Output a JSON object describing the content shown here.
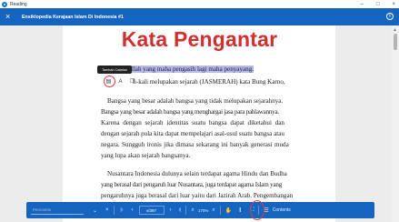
{
  "window": {
    "app_title": "Reading",
    "controls": {
      "minimize": "–",
      "maximize": "□",
      "close": "×"
    }
  },
  "appbar": {
    "close_icon": "×",
    "book_title": "Ensiklopedia Kerajaan Islam Di Indonesia #1",
    "info_icon": "i"
  },
  "page": {
    "heading": "Kata Pengantar",
    "highlighted_line": "nama Allah yang maha pengasih lagi maha penyayang.",
    "lines": [
      "li-kali melupakan sejarah (JASMERAH) kata Bung Karno,",
      "Bangsa yang besar adalah bangsa yang tidak melupakan sejarahnya.",
      "Bangsa yang besar adalah bangsa yang menghargai jasa para pahlawannya.",
      "Karena dengan sejarah identitas suatu bangsa dapat diketahui dan",
      "dengan sejarah pula kita dapat mempelajari asal-usul suatu bangsa atau",
      "negara. Sungguh ironis jika dimasa sekarang ini banyak generasi muda",
      "yang lupa akan sejarah bangsanya.",
      "Nusantara Indonesia dulunya selain terdapat agama Hindu dan Budha",
      "yang berasal dari pengaruh luar Nusantara, juga terdapat agama Islam yang",
      "pengaruhnya juga berasal dari luar yaitu dari Jazirah Arab. Pengembangan"
    ]
  },
  "tooltip": {
    "text": "Tambah Catatan"
  },
  "mini_toolbar": {
    "note_icon": "▤",
    "text_icon": "A",
    "copy_icon": "❐"
  },
  "toolbar": {
    "search_placeholder": "Pencarian",
    "page_value": "v/397",
    "zoom_value": "170%",
    "contents_label": "Contents",
    "icons": {
      "dropdown": "⌄",
      "close": "×",
      "first": "|‹",
      "prev": "‹",
      "next": "›",
      "last": "›|",
      "zoom_out": "⌕",
      "zoom_in": "⌕",
      "hand": "✋",
      "cursor": "I",
      "fit": "⛶",
      "list": "☰"
    }
  }
}
